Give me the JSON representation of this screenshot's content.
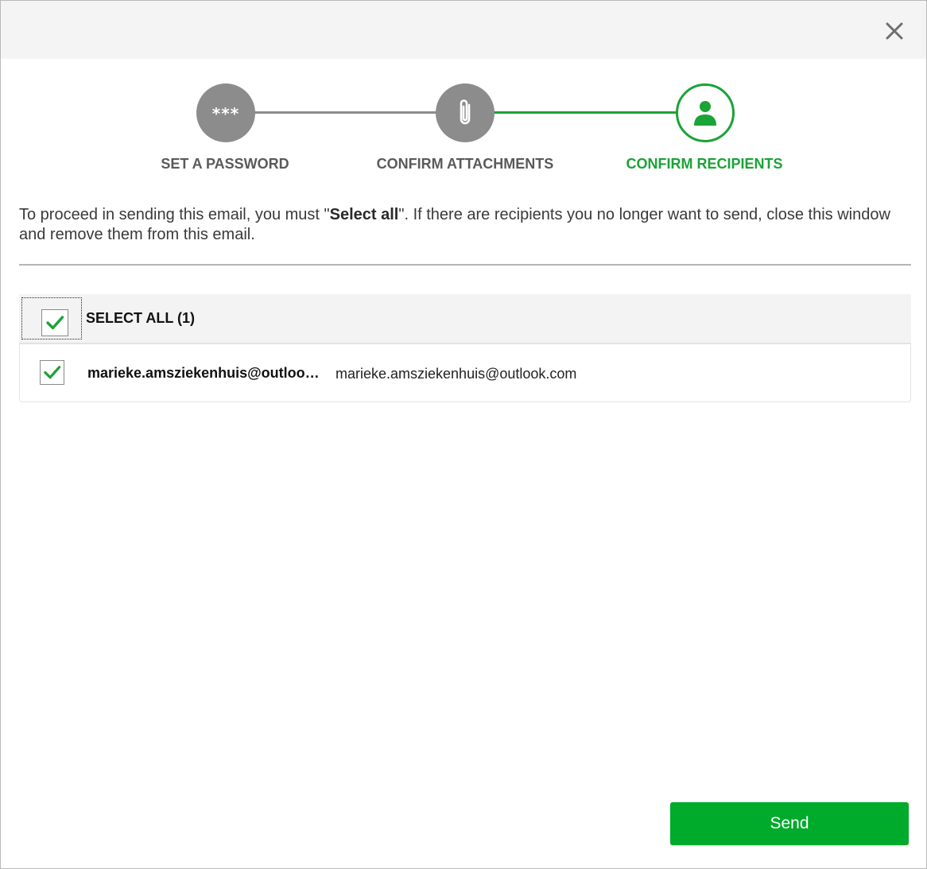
{
  "colors": {
    "accent_green": "#1aa336",
    "send_green": "#00aa2b",
    "step_inactive": "#8c8c8c",
    "label_gray": "#5a5a5a"
  },
  "dialog": {
    "close_icon": "close-icon"
  },
  "steps": [
    {
      "label": "SET A PASSWORD",
      "icon": "password-asterisks-icon",
      "icon_text": "***",
      "state": "completed"
    },
    {
      "label": "CONFIRM ATTACHMENTS",
      "icon": "paperclip-icon",
      "state": "completed"
    },
    {
      "label": "CONFIRM RECIPIENTS",
      "icon": "user-icon",
      "state": "active"
    }
  ],
  "instructions": {
    "before": "To proceed in sending this email, you must \"",
    "bold": "Select all",
    "after": "\". If there are recipients you no longer want to send, close this window and remove them from this email."
  },
  "recipients_table": {
    "select_all_label": "SELECT ALL (1)",
    "select_all_checked": true,
    "rows": [
      {
        "name": "marieke.amsziekenhuis@outlook.com",
        "email": "marieke.amsziekenhuis@outlook.com",
        "checked": true
      }
    ]
  },
  "footer": {
    "send_label": "Send"
  }
}
